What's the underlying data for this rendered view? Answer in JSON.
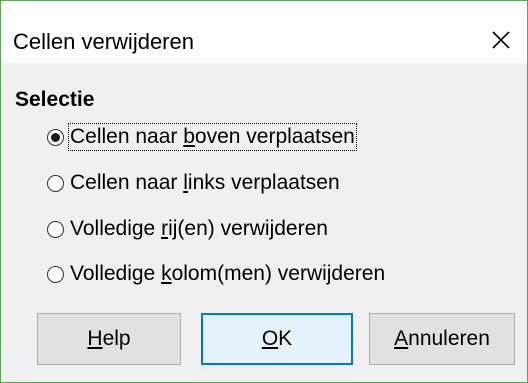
{
  "window": {
    "title": "Cellen verwijderen",
    "close_icon": "close-icon"
  },
  "section": {
    "title": "Selectie"
  },
  "options": [
    {
      "pre": "Cellen naar ",
      "mn": "b",
      "post": "oven verplaatsen",
      "checked": true
    },
    {
      "pre": "Cellen naar ",
      "mn": "l",
      "post": "inks verplaatsen",
      "checked": false
    },
    {
      "pre": "Volledige ",
      "mn": "r",
      "post": "ij(en) verwijderen",
      "checked": false
    },
    {
      "pre": "Volledige ",
      "mn": "k",
      "post": "olom(men) verwijderen",
      "checked": false
    }
  ],
  "buttons": {
    "help": {
      "mn": "H",
      "post": "elp"
    },
    "ok": {
      "mn": "O",
      "post": "K"
    },
    "cancel": {
      "mn": "A",
      "post": "nnuleren"
    }
  },
  "colors": {
    "window_border": "#58a35a",
    "default_button_border": "#0078d7"
  }
}
